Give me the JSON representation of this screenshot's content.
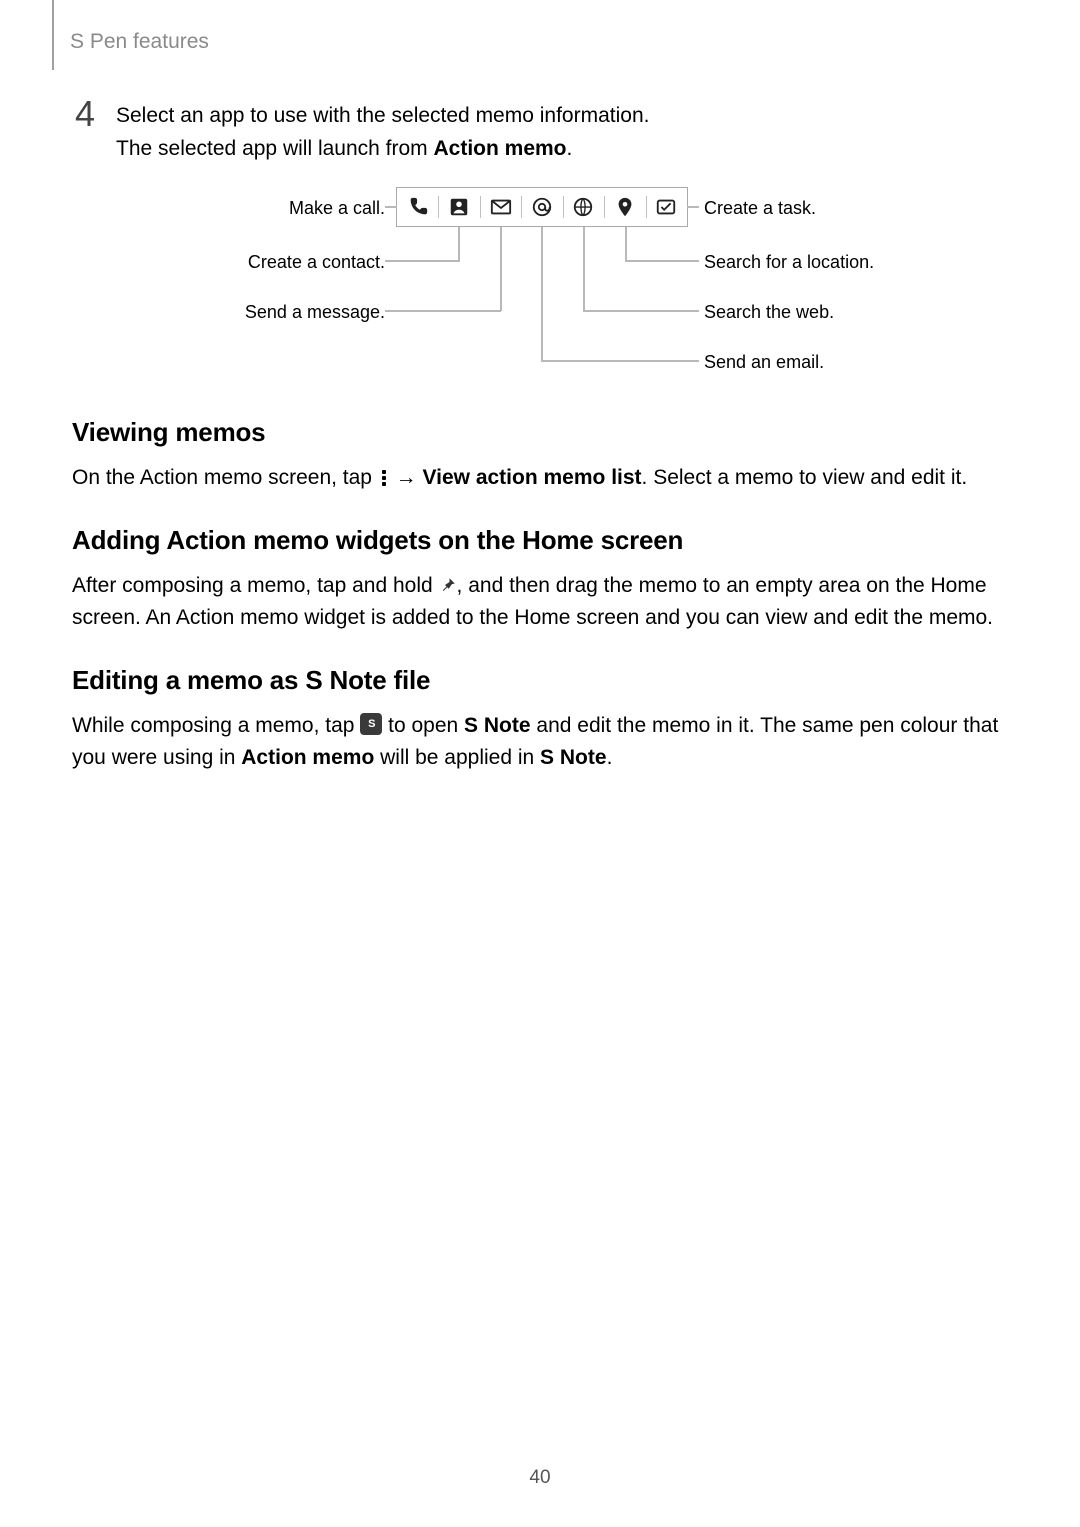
{
  "header": {
    "section_title": "S Pen features"
  },
  "step": {
    "number": "4",
    "line1_pre": "Select an app to use with the selected memo information.",
    "line2_pre": "The selected app will launch from ",
    "line2_bold": "Action memo",
    "line2_post": "."
  },
  "diagram": {
    "left": [
      "Make a call.",
      "Create a contact.",
      "Send a message."
    ],
    "right": [
      "Create a task.",
      "Search for a location.",
      "Search the web.",
      "Send an email."
    ],
    "icons": [
      "phone-icon",
      "contact-icon",
      "message-icon",
      "email-at-icon",
      "web-globe-icon",
      "location-pin-icon",
      "task-check-icon"
    ]
  },
  "sections": {
    "viewing": {
      "title": "Viewing memos",
      "p1_pre": "On the Action memo screen, tap ",
      "p1_arrow": " → ",
      "p1_bold": "View action memo list",
      "p1_post": ". Select a memo to view and edit it."
    },
    "adding": {
      "title": "Adding Action memo widgets on the Home screen",
      "p1_pre": "After composing a memo, tap and hold ",
      "p1_post": ", and then drag the memo to an empty area on the Home screen. An Action memo widget is added to the Home screen and you can view and edit the memo."
    },
    "editing": {
      "title": "Editing a memo as S Note file",
      "p1_pre": "While composing a memo, tap ",
      "p1_mid1": " to open ",
      "p1_b1": "S Note",
      "p1_mid2": " and edit the memo in it. The same pen colour that you were using in ",
      "p1_b2": "Action memo",
      "p1_mid3": " will be applied in ",
      "p1_b3": "S Note",
      "p1_post": "."
    }
  },
  "page_number": "40"
}
